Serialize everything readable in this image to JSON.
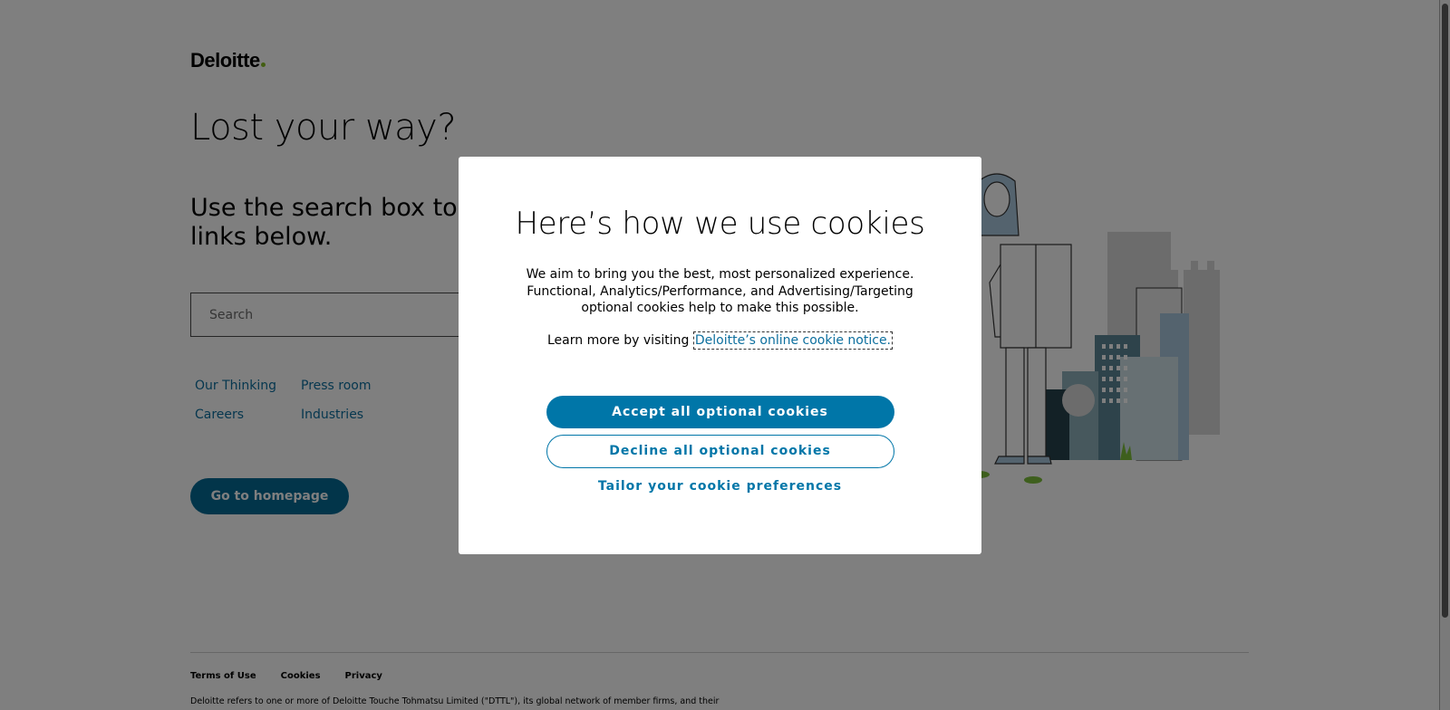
{
  "header": {
    "logo_text": "Deloitte",
    "brand_dot_color": "#86bc25"
  },
  "main": {
    "headline": "Lost your way?",
    "subline_part1": "Use the search box to get back on track, or try the",
    "subline_part2": "links below.",
    "search": {
      "placeholder": "Search"
    },
    "links": [
      "Our Thinking",
      "Press room",
      "Careers",
      "Industries"
    ],
    "home_button": "Go to homepage"
  },
  "footer": {
    "links": [
      "Terms of Use",
      "Cookies",
      "Privacy"
    ],
    "text": "Deloitte refers to one or more of Deloitte Touche Tohmatsu Limited (\"DTTL\"), its global network of member firms, and their"
  },
  "cookie_modal": {
    "title": "Here’s how we use cookies",
    "body": "We aim to bring you the best, most personalized experience. Functional, Analytics/Performance, and Advertising/Targeting optional cookies help to make this possible.",
    "learn_prefix": "Learn more by visiting",
    "learn_link": "Deloitte’s online cookie notice.",
    "accept": "Accept all optional cookies",
    "decline": "Decline all optional cookies",
    "tailor": "Tailor your cookie preferences"
  },
  "colors": {
    "primary": "#0076a8",
    "link": "#0d6f9e",
    "home_button": "#046a94",
    "overlay": "rgba(0,0,0,0.5)"
  }
}
